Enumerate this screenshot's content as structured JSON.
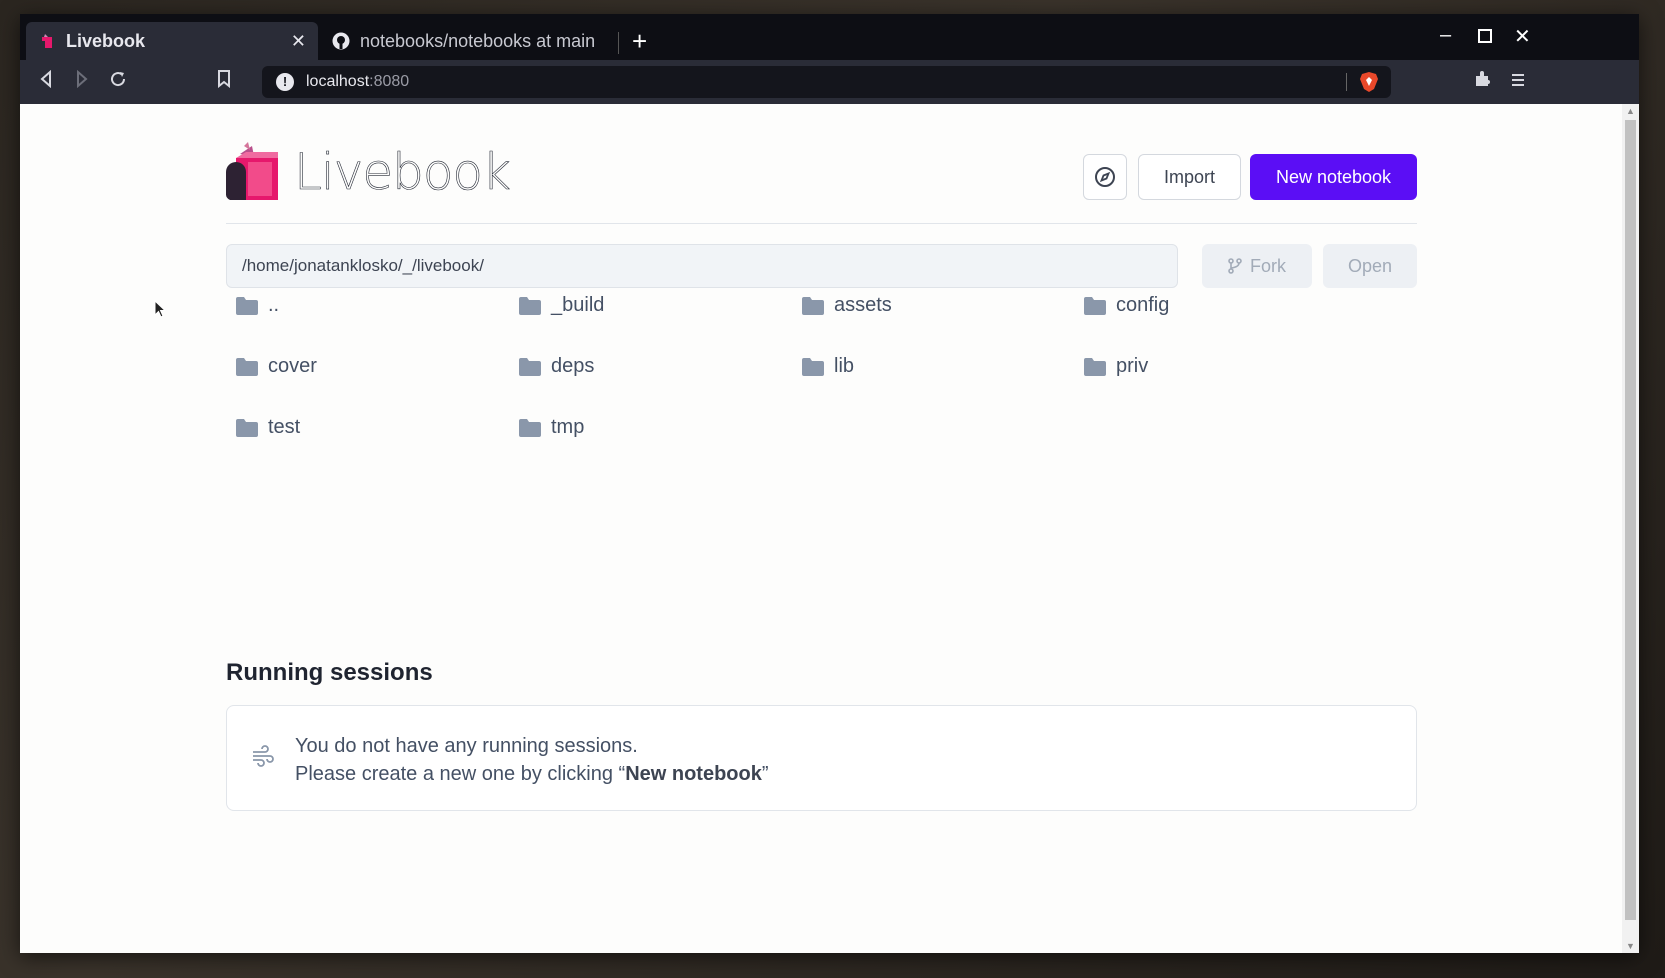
{
  "browser": {
    "tabs": [
      {
        "title": "Livebook",
        "active": true
      },
      {
        "title": "notebooks/notebooks at main",
        "active": false
      }
    ],
    "url_host": "localhost",
    "url_port": ":8080"
  },
  "header": {
    "logo_text": "Livebook",
    "import_label": "Import",
    "new_notebook_label": "New notebook"
  },
  "path": {
    "value": "/home/jonatanklosko/_/livebook/",
    "fork_label": "Fork",
    "open_label": "Open"
  },
  "entries": [
    {
      "name": ".."
    },
    {
      "name": "_build"
    },
    {
      "name": "assets"
    },
    {
      "name": "config"
    },
    {
      "name": "cover"
    },
    {
      "name": "deps"
    },
    {
      "name": "lib"
    },
    {
      "name": "priv"
    },
    {
      "name": "test"
    },
    {
      "name": "tmp"
    }
  ],
  "sessions": {
    "title": "Running sessions",
    "line1": "You do not have any running sessions.",
    "line2_prefix": "Please create a new one by clicking “",
    "line2_bold": "New notebook",
    "line2_suffix": "”"
  },
  "colors": {
    "accent": "#5b0ef5",
    "folder": "#8a97aa"
  }
}
